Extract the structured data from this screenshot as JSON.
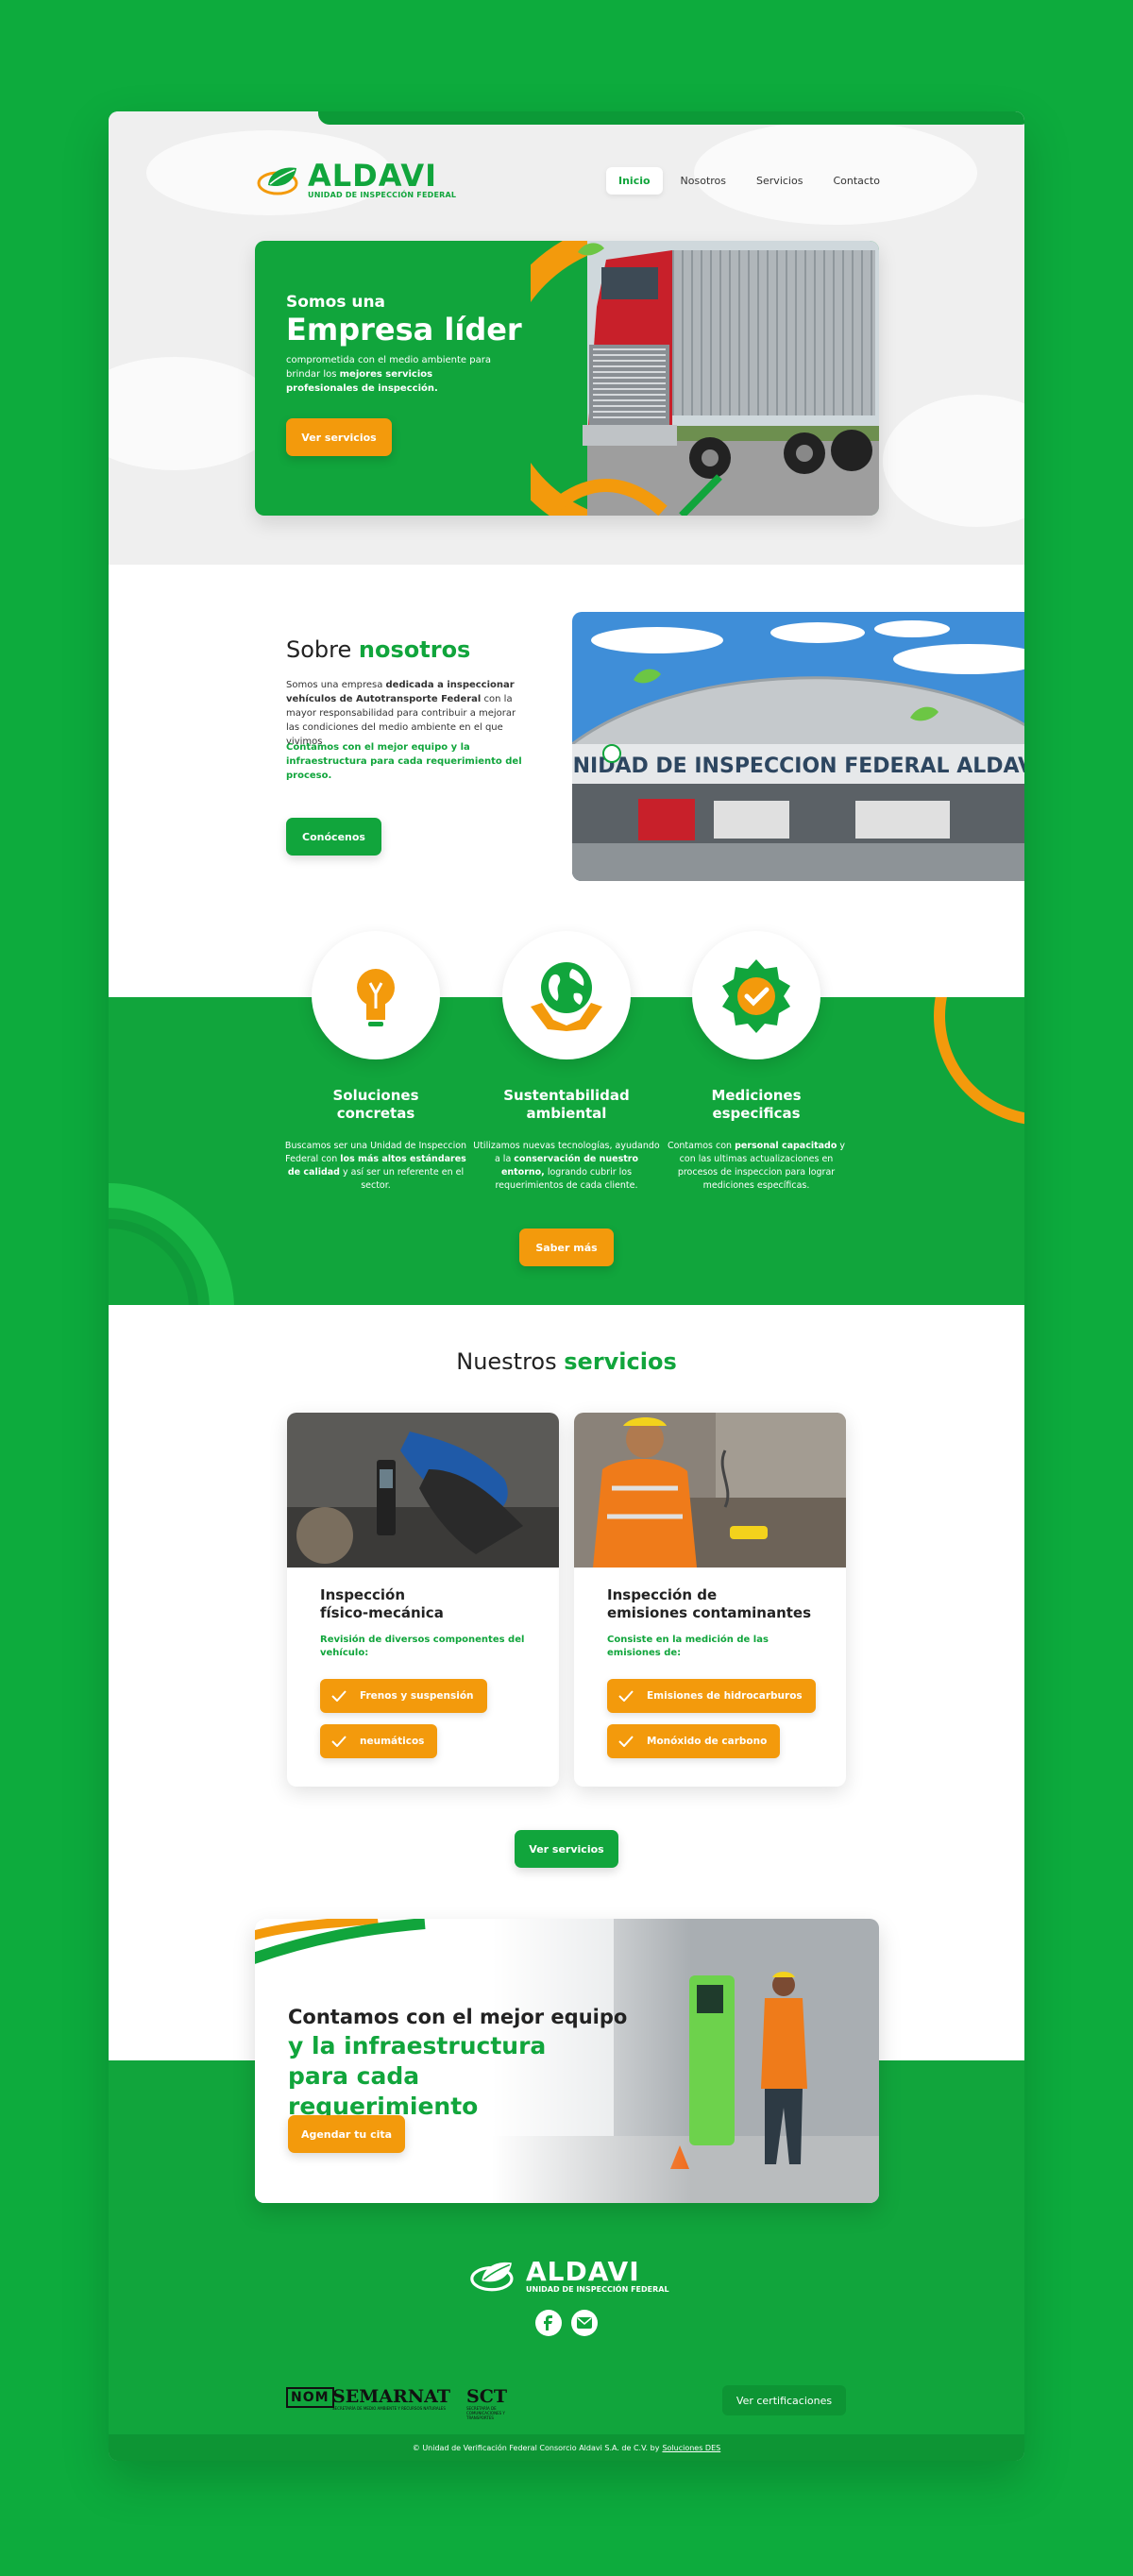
{
  "brand": {
    "name": "ALDAVI",
    "subtitle": "UNIDAD DE INSPECCIÓN FEDERAL"
  },
  "nav": [
    {
      "label": "Inicio",
      "active": true
    },
    {
      "label": "Nosotros"
    },
    {
      "label": "Servicios"
    },
    {
      "label": "Contacto"
    }
  ],
  "hero": {
    "line1": "Somos una",
    "line2": "Empresa líder",
    "text_a": "comprometida con el medio ambiente para brindar los ",
    "text_b": "mejores servicios profesionales de inspección.",
    "button": "Ver servicios"
  },
  "about": {
    "title_a": "Sobre",
    "title_b": "nosotros",
    "p_a": "Somos una empresa ",
    "p_b": "dedicada a inspeccionar vehículos de Autotransporte Federal",
    "p_c": " con la mayor responsabilidad para contribuir a mejorar las condiciones del medio ambiente en el que vivimos",
    "highlight": "Contamos con el mejor equipo y la infraestructura para cada requerimiento del proceso.",
    "button": "Conócenos",
    "image_sign": "UNIDAD DE INSPECCION FEDERAL ALDAVI",
    "image_sign_small": "ALDAVI"
  },
  "features": [
    {
      "title": "Soluciones concretas",
      "text_a": "Buscamos ser una Unidad de Inspeccion Federal con ",
      "text_b": "los más altos estándares de calidad",
      "text_c": " y así ser un referente en el sector.",
      "icon": "lightbulb-icon"
    },
    {
      "title": "Sustentabilidad ambiental",
      "text_a": "Utilizamos nuevas tecnologías, ayudando a la ",
      "text_b": "conservación de nuestro entorno,",
      "text_c": " logrando cubrir los requerimientos de cada cliente.",
      "icon": "globe-hands-icon"
    },
    {
      "title": "Mediciones especificas",
      "text_a": "Contamos con ",
      "text_b": "personal capacitado",
      "text_c": " y con las ultimas actualizaciones en procesos de inspeccion para lograr mediciones específicas.",
      "icon": "badge-check-icon"
    }
  ],
  "features_button": "Saber más",
  "services": {
    "title_a": "Nuestros",
    "title_b": "servicios",
    "cards": [
      {
        "title_1": "Inspección",
        "title_2": "físico-mecánica",
        "subtitle": "Revisión de diversos componentes del vehículo:",
        "items": [
          "Frenos y suspensión",
          "neumáticos"
        ]
      },
      {
        "title_1": "Inspección de",
        "title_2": "emisiones contaminantes",
        "subtitle": "Consiste en la medición de las emisiones de:",
        "items": [
          "Emisiones de hidrocarburos",
          "Monóxido de carbono"
        ]
      }
    ],
    "button": "Ver servicios"
  },
  "cta": {
    "line1": "Contamos con el mejor equipo",
    "line2": "y la infraestructura para cada requerimiento",
    "button": "Agendar tu cita"
  },
  "footer": {
    "partners": [
      "NOM",
      "SEMARNAT",
      "SCT"
    ],
    "semarnat_sub": "SECRETARÍA DE MEDIO AMBIENTE Y RECURSOS NATURALES",
    "sct_sub": "SECRETARÍA DE COMUNICACIONES Y TRANSPORTES",
    "cert_button": "Ver certificaciones",
    "copyright": "© Unidad de Verificación Federal Consorcio Aldavi S.A. de C.V. by",
    "credit": "Soluciones DES"
  },
  "colors": {
    "green": "#11a53c",
    "orange": "#f39a0c",
    "background": "#0dab3d"
  }
}
